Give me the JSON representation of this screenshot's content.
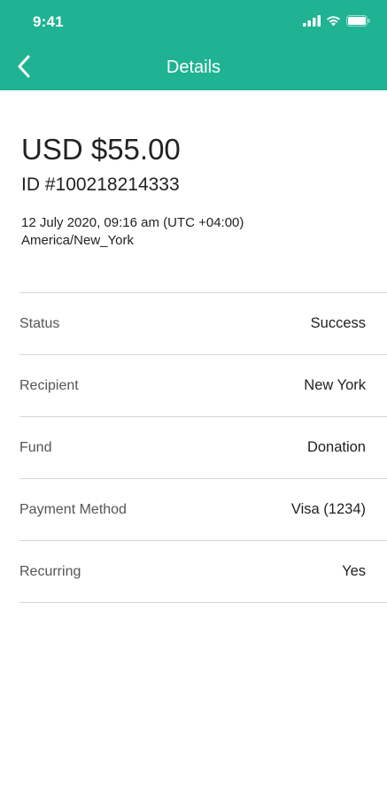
{
  "status_bar": {
    "time": "9:41",
    "icons": [
      "signal-icon",
      "wifi-icon",
      "battery-icon"
    ]
  },
  "nav": {
    "title": "Details",
    "back_icon": "chevron-left-icon"
  },
  "colors": {
    "header": "#1fb393",
    "divider": "#d6d6d6"
  },
  "summary": {
    "amount": "USD $55.00",
    "id": "ID #100218214333",
    "datetime": "12 July 2020, 09:16 am (UTC +04:00)",
    "timezone": "America/New_York"
  },
  "details": [
    {
      "label": "Status",
      "value": "Success"
    },
    {
      "label": "Recipient",
      "value": "New York"
    },
    {
      "label": "Fund",
      "value": "Donation"
    },
    {
      "label": "Payment Method",
      "value": "Visa (1234)"
    },
    {
      "label": "Recurring",
      "value": "Yes"
    }
  ]
}
